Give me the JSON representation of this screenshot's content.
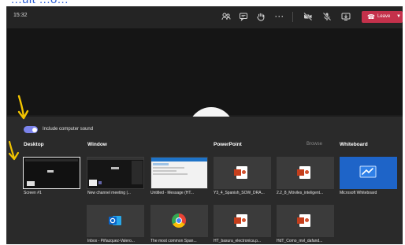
{
  "top_caption": "...uit ...o...",
  "topbar": {
    "time": "15:32",
    "icons": [
      "people-icon",
      "chat-icon",
      "raise-hand-icon",
      "more-icon",
      "camera-off-icon",
      "mic-off-icon",
      "share-tray-icon"
    ],
    "leave_label": "Leave"
  },
  "share_tray": {
    "include_sound_label": "Include computer sound",
    "include_sound_on": true,
    "sections": {
      "desktop": "Desktop",
      "window": "Window",
      "powerpoint": "PowerPoint",
      "browse": "Browse",
      "whiteboard": "Whiteboard"
    },
    "desktop_items": [
      "Screen #1"
    ],
    "window_items": [
      "New channel meeting |...",
      "Untitled - Message (HT...",
      "Inbox - Piñazquez-Valero...",
      "The most common Span..."
    ],
    "powerpoint_items": [
      "Y3_4_Spanish_SOW_DRA...",
      "2.2_8_Móviles_inteligent...",
      "HT_basura_electronica.p...",
      "HdT_Como_mvl_dafand..."
    ],
    "whiteboard_items": [
      "Microsoft Whiteboard"
    ]
  },
  "colors": {
    "leave": "#c4314b",
    "toggle": "#7b83eb",
    "annotation_arrow": "#f2c400",
    "whiteboard_tile": "#1e64c8"
  }
}
